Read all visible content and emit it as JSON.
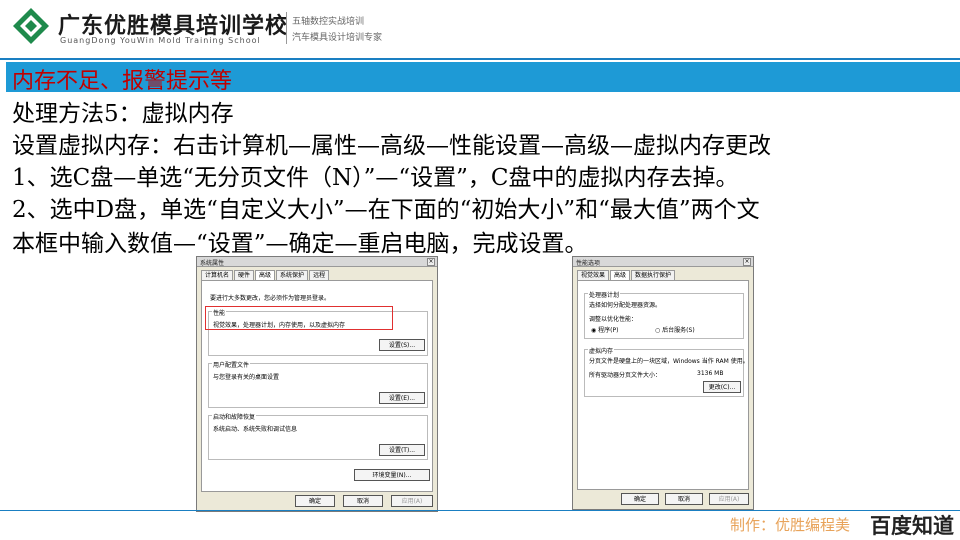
{
  "header": {
    "school_name": "广东优胜模具培训学校",
    "school_en": "GuangDong YouWin Mold Training School",
    "slogan1": "五轴数控实战培训",
    "slogan2": "汽车模具设计培训专家",
    "brand_color": "#1a7fc2"
  },
  "title": "内存不足、报警提示等",
  "content": {
    "line1": "处理方法5：虚拟内存",
    "line2": "设置虚拟内存：右击计算机—属性—高级—性能设置—高级—虚拟内存更改",
    "line3": "1、选C盘—单选“无分页文件（N）”—“设置”，C盘中的虚拟内存去掉。",
    "line4": "2、选中D盘，单选“自定义大小”—在下面的“初始大小”和“最大值”两个文",
    "line5": "本框中输入数值—“设置”—确定—重启电脑，完成设置。"
  },
  "dialog1": {
    "title": "系统属性",
    "tabs": [
      "计算机名",
      "硬件",
      "高级",
      "系统保护",
      "远程"
    ],
    "notice": "要进行大多数更改，您必须作为管理员登录。",
    "performance_title": "性能",
    "performance_desc": "视觉效果，处理器计划，内存使用，以及虚拟内存",
    "profile_title": "用户配置文件",
    "profile_desc": "与您登录有关的桌面设置",
    "startup_title": "启动和故障恢复",
    "startup_desc": "系统启动、系统失败和调试信息",
    "settings_label": "设置(S)...",
    "settings_label2": "设置(E)...",
    "settings_label3": "设置(T)...",
    "env_label": "环境变量(N)...",
    "ok": "确定",
    "cancel": "取消",
    "apply": "应用(A)"
  },
  "dialog2": {
    "title": "性能选项",
    "tabs": [
      "视觉效果",
      "高级",
      "数据执行保护"
    ],
    "sched_title": "处理器计划",
    "sched_desc": "选择如何分配处理器资源。",
    "sched_sub": "调整以优化性能：",
    "opt1": "程序(P)",
    "opt2": "后台服务(S)",
    "vm_title": "虚拟内存",
    "vm_desc": "分页文件是硬盘上的一块区域，Windows 当作 RAM 使用。",
    "vm_total_label": "所有驱动器分页文件大小：",
    "vm_total_value": "3136 MB",
    "change_label": "更改(C)...",
    "ok": "确定",
    "cancel": "取消",
    "apply": "应用(A)"
  },
  "footer": {
    "note": "制作：优胜编程美",
    "brand": "百度知道"
  }
}
